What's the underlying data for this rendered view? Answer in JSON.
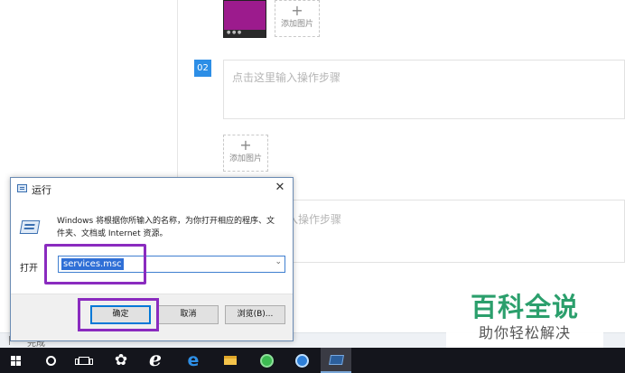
{
  "editor": {
    "add_image_label": "添加图片",
    "add_image_plus": "+",
    "step_number": "02",
    "step_placeholder": "点击这里输入操作步骤",
    "step3_placeholder_visible": "入操作步骤",
    "bottom_label": "完成"
  },
  "dialog": {
    "title": "运行",
    "close_glyph": "✕",
    "description": "Windows 将根据你所输入的名称，为你打开相应的程序、文件夹、文档或 Internet 资源。",
    "open_label": "打开",
    "input_value": "services.msc",
    "dropdown_glyph": "⌄",
    "buttons": {
      "ok": "确定",
      "cancel": "取消",
      "browse": "浏览(B)..."
    }
  },
  "watermark": {
    "title": "百科全说",
    "subtitle": "助你轻松解决"
  },
  "taskbar": {
    "icons": [
      "windows-start-icon",
      "cortana-search-icon",
      "task-view-icon",
      "pinwheel-app-icon",
      "ie-browser-icon",
      "edge-browser-icon",
      "file-explorer-icon",
      "green-browser-icon",
      "qq-browser-icon",
      "run-dialog-icon"
    ],
    "ie_glyph": "ℯ",
    "edge_glyph": "e",
    "pinwheel_glyph": "✿"
  },
  "colors": {
    "accent_blue": "#2d8ee6",
    "highlight_purple": "#8a2bbf",
    "watermark_green": "#2b9f6c",
    "taskbar_bg": "#14151c",
    "thumbnail_purple": "#9c1b8d"
  }
}
